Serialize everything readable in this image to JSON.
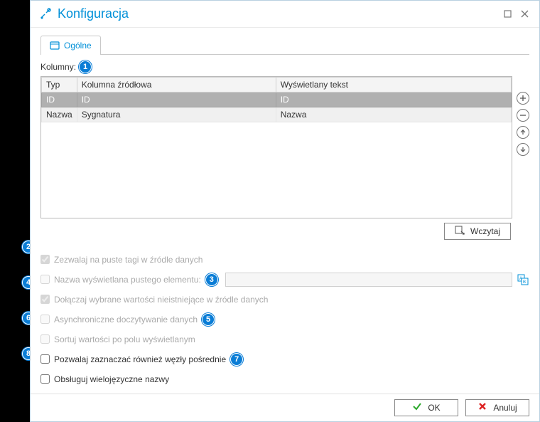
{
  "window": {
    "title": "Konfiguracja",
    "tab_general": "Ogólne",
    "columns_label": "Kolumny:"
  },
  "badges": [
    "1",
    "2",
    "3",
    "4",
    "5",
    "6",
    "7",
    "8"
  ],
  "grid": {
    "headers": {
      "type": "Typ",
      "source": "Kolumna źródłowa",
      "display": "Wyświetlany tekst"
    },
    "rows": [
      {
        "type": "ID",
        "source": "ID",
        "display": "ID",
        "selected": true
      },
      {
        "type": "Nazwa",
        "source": "Sygnatura",
        "display": "Nazwa",
        "selected": false
      }
    ]
  },
  "buttons": {
    "load": "Wczytaj",
    "ok": "OK",
    "cancel": "Anuluj"
  },
  "options": {
    "allow_empty_tags": {
      "label": "Zezwalaj na puste tagi w źródle danych",
      "checked": true,
      "disabled": true
    },
    "empty_display_name": {
      "label": "Nazwa wyświetlana pustego elementu:",
      "checked": false,
      "disabled": true,
      "value": ""
    },
    "append_missing": {
      "label": "Dołączaj wybrane wartości nieistniejące w źródle danych",
      "checked": true,
      "disabled": true
    },
    "async_load": {
      "label": "Asynchroniczne doczytywanie danych",
      "checked": false,
      "disabled": true
    },
    "sort_by_display": {
      "label": "Sortuj wartości po polu wyświetlanym",
      "checked": false,
      "disabled": true
    },
    "allow_intermediate_nodes": {
      "label": "Pozwalaj zaznaczać również węzły pośrednie",
      "checked": false,
      "disabled": false
    },
    "multilang_names": {
      "label": "Obsługuj wielojęzyczne nazwy",
      "checked": false,
      "disabled": false
    }
  }
}
